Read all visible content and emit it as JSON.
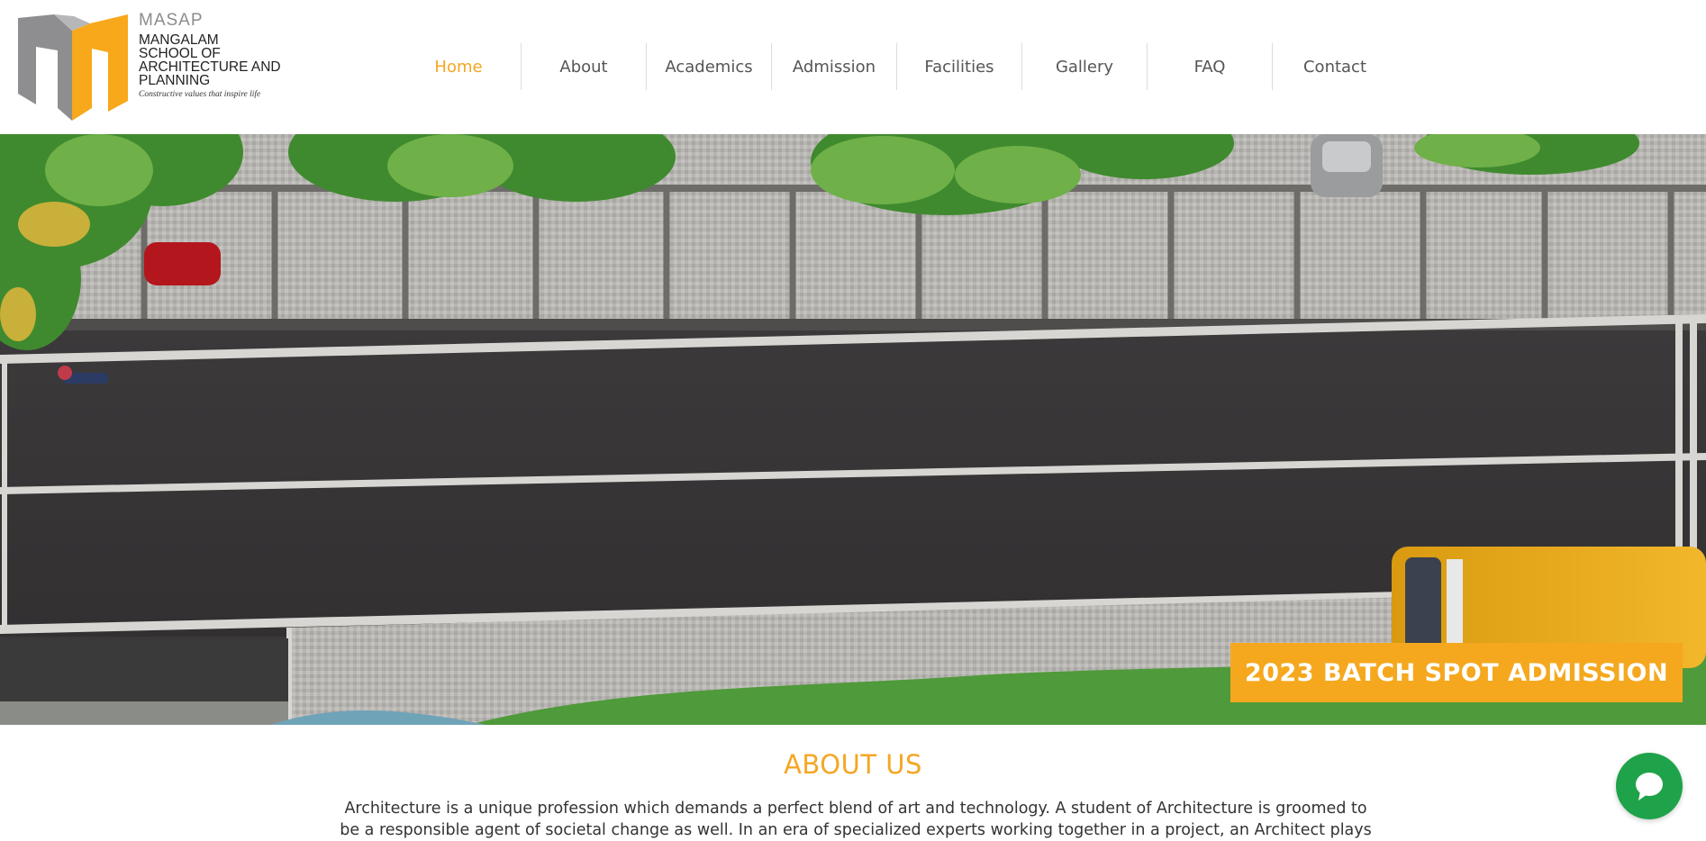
{
  "logo": {
    "abbr": "MASAP",
    "name_lines": [
      "MANGALAM",
      "SCHOOL OF",
      "ARCHITECTURE AND",
      "PLANNING"
    ],
    "tagline": "Constructive values that inspire life",
    "colors": {
      "gray": "#8e8e90",
      "orange": "#f7a81b"
    }
  },
  "nav": {
    "items": [
      {
        "label": "Home",
        "active": true
      },
      {
        "label": "About"
      },
      {
        "label": "Academics"
      },
      {
        "label": "Admission"
      },
      {
        "label": "Facilities"
      },
      {
        "label": "Gallery"
      },
      {
        "label": "FAQ"
      },
      {
        "label": "Contact"
      }
    ],
    "active_color": "#f5a623"
  },
  "hero": {
    "cta_label": "2023 BATCH SPOT ADMISSION",
    "cta_color": "#f5a81e",
    "image": "aerial view of campus road with palm trees and yellow bus"
  },
  "about": {
    "title": "ABOUT US",
    "text": "Architecture is a unique profession which demands a perfect blend of art and technology. A student of Architecture is groomed to be a responsible agent of societal change as well. In an era of specialized experts working together in a project, an Architect plays"
  },
  "chat": {
    "icon": "chat-bubble-icon",
    "color": "#1fa34a"
  }
}
